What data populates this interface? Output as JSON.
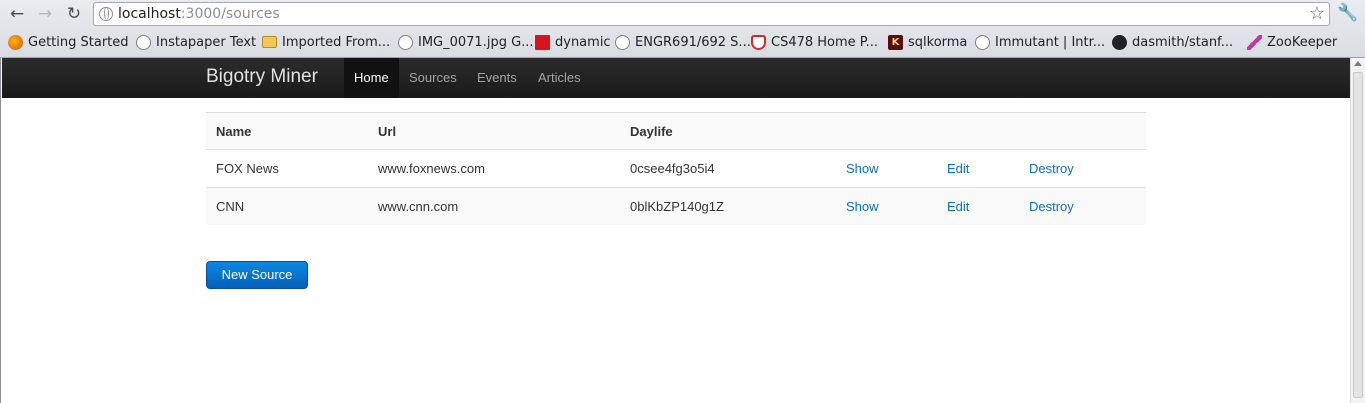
{
  "browser": {
    "url_host": "localhost",
    "url_path": ":3000/sources",
    "bookmarks": [
      {
        "label": "Getting Started",
        "icon": "firefox-icon"
      },
      {
        "label": "Instapaper Text",
        "icon": "globe-icon"
      },
      {
        "label": "Imported From...",
        "icon": "folder-icon"
      },
      {
        "label": "IMG_0071.jpg G...",
        "icon": "globe-icon"
      },
      {
        "label": "dynamic",
        "icon": "red-bracket-icon"
      },
      {
        "label": "ENGR691/692 S...",
        "icon": "globe-icon"
      },
      {
        "label": "CS478 Home P...",
        "icon": "shield-icon"
      },
      {
        "label": "sqlkorma",
        "icon": "k-icon"
      },
      {
        "label": "Immutant | Intr...",
        "icon": "globe-icon"
      },
      {
        "label": "dasmith/stanf...",
        "icon": "github-icon"
      },
      {
        "label": "ZooKeeper",
        "icon": "feather-icon"
      }
    ]
  },
  "app": {
    "brand": "Bigotry Miner",
    "nav": [
      "Home",
      "Sources",
      "Events",
      "Articles"
    ],
    "active_nav": "Home"
  },
  "table": {
    "headers": [
      "Name",
      "Url",
      "Daylife"
    ],
    "rows": [
      {
        "name": "FOX News",
        "url": "www.foxnews.com",
        "daylife": "0csee4fg3o5i4",
        "show": "Show",
        "edit": "Edit",
        "destroy": "Destroy"
      },
      {
        "name": "CNN",
        "url": "www.cnn.com",
        "daylife": "0blKbZP140g1Z",
        "show": "Show",
        "edit": "Edit",
        "destroy": "Destroy"
      }
    ]
  },
  "actions": {
    "new_source": "New Source"
  },
  "colors": {
    "navbar": "#1b1b1b",
    "link": "#0a6fc2",
    "primary_button": "#0a7bd6"
  }
}
